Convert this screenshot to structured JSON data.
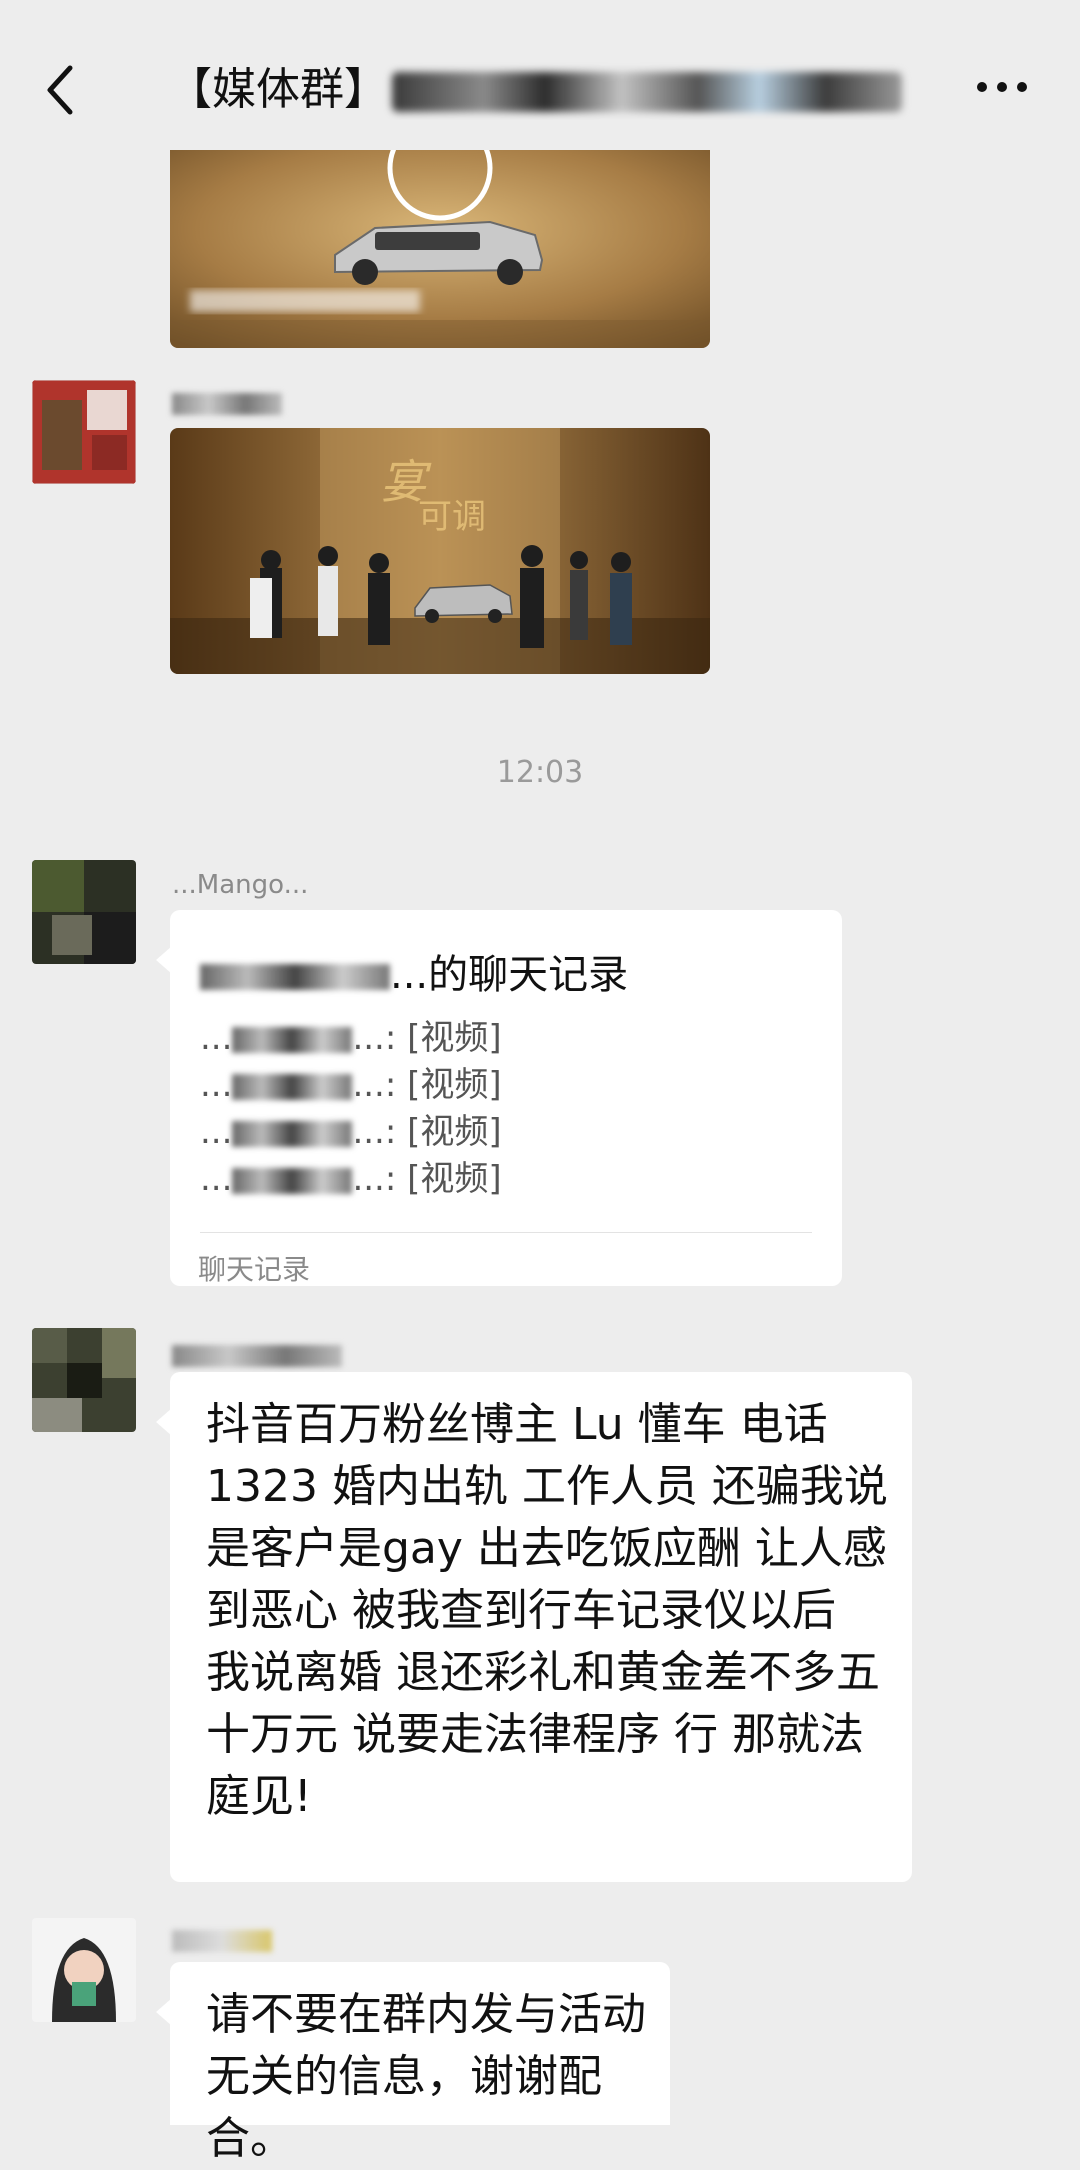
{
  "header": {
    "title": "【媒体群】",
    "back_icon": "chevron-left-icon",
    "more_icon": "more-dots-icon"
  },
  "timestamp": "12:03",
  "chat_record": {
    "sender": "...Mango...",
    "title_suffix": "...的聊天记录",
    "lines": [
      "...: [视频]",
      "...: [视频]",
      "...: [视频]",
      "...: [视频]"
    ],
    "footer": "聊天记录"
  },
  "message_complaint": {
    "text": "抖音百万粉丝博主 Lu   懂车    电话 1323     婚内出轨  工作人员 还骗我说是客户是gay 出去吃饭应酬 让人感到恶心 被我查到行车记录仪以后 我说离婚 退还彩礼和黄金差不多五十万元 说要走法律程序 行 那就法庭见!"
  },
  "message_admin": {
    "text": "请不要在群内发与活动无关的信息，谢谢配合。"
  },
  "colors": {
    "background": "#ededed",
    "bubble": "#ffffff",
    "phone_link": "#576b95"
  }
}
